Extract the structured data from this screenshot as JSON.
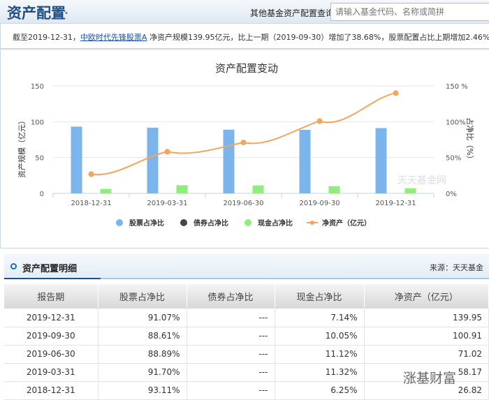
{
  "header": {
    "title": "资产配置",
    "search_label": "其他基金资产配置查询:",
    "search_placeholder": "请输入基金代码、名称或简拼"
  },
  "info": {
    "prefix": "截至2019-12-31，",
    "fund_link": "中欧时代先锋股票A",
    "suffix": " 净资产规模139.95亿元，比上一期（2019-09-30）增加了38.68%，股票配置占比上期增加2.46%"
  },
  "chart_data": {
    "type": "bar+line",
    "title": "资产配置变动",
    "categories": [
      "2018-12-31",
      "2019-03-31",
      "2019-06-30",
      "2019-09-30",
      "2019-12-31"
    ],
    "ylabel": "资产规模（亿元）",
    "ylabel_right": "占净比（%）",
    "ylim": [
      0,
      150
    ],
    "yticks": [
      "0",
      "50",
      "100",
      "150"
    ],
    "yticks_right": [
      "0%",
      "50%",
      "100%",
      "150 %"
    ],
    "series": [
      {
        "name": "股票占净比",
        "type": "bar",
        "color": "#7cb5ec",
        "values": [
          93.11,
          91.7,
          88.89,
          88.61,
          91.07
        ]
      },
      {
        "name": "债券占净比",
        "type": "bar",
        "color": "#434348",
        "values": [
          0,
          0,
          0,
          0,
          0
        ]
      },
      {
        "name": "现金占净比",
        "type": "bar",
        "color": "#90ed7d",
        "values": [
          6.25,
          11.32,
          11.12,
          10.05,
          7.14
        ]
      },
      {
        "name": "净资产（亿元）",
        "type": "line",
        "color": "#f7a35c",
        "values": [
          26.82,
          58.17,
          71.02,
          100.91,
          139.95
        ]
      }
    ],
    "watermark": "天天基金网"
  },
  "section": {
    "title": "资产配置明细",
    "source": "来源：天天基金"
  },
  "table": {
    "headers": [
      "报告期",
      "股票占净比",
      "债券占净比",
      "现金占净比",
      "净资产（亿元）"
    ],
    "rows": [
      [
        "2019-12-31",
        "91.07%",
        "---",
        "7.14%",
        "139.95"
      ],
      [
        "2019-09-30",
        "88.61%",
        "---",
        "10.05%",
        "100.91"
      ],
      [
        "2019-06-30",
        "88.89%",
        "---",
        "11.12%",
        "71.02"
      ],
      [
        "2019-03-31",
        "91.70%",
        "---",
        "11.32%",
        "58.17"
      ],
      [
        "2018-12-31",
        "93.11%",
        "---",
        "6.25%",
        "26.82"
      ]
    ]
  },
  "watermark": "涨基财富"
}
